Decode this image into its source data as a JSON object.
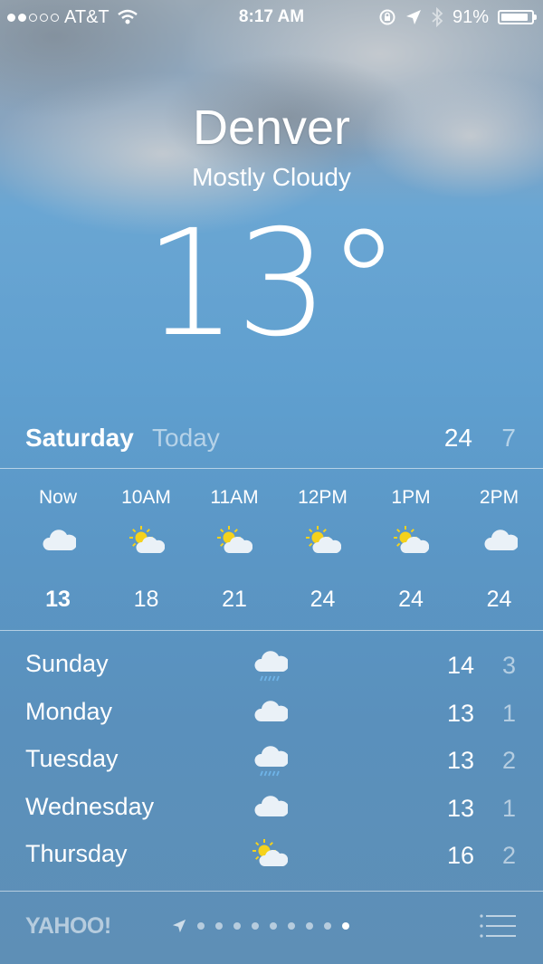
{
  "status_bar": {
    "carrier": "AT&T",
    "signal_bars_filled": 2,
    "signal_bars_total": 5,
    "time": "8:17 AM",
    "battery": "91%",
    "battery_level": 0.91
  },
  "header": {
    "city": "Denver",
    "condition": "Mostly Cloudy",
    "temperature": "13°"
  },
  "today": {
    "day": "Saturday",
    "label": "Today",
    "high": "24",
    "low": "7"
  },
  "hourly": [
    {
      "time": "Now",
      "icon": "cloud-icon",
      "temp": "13"
    },
    {
      "time": "10AM",
      "icon": "partly-sunny-icon",
      "temp": "18"
    },
    {
      "time": "11AM",
      "icon": "partly-sunny-icon",
      "temp": "21"
    },
    {
      "time": "12PM",
      "icon": "partly-sunny-icon",
      "temp": "24"
    },
    {
      "time": "1PM",
      "icon": "partly-sunny-icon",
      "temp": "24"
    },
    {
      "time": "2PM",
      "icon": "cloud-icon",
      "temp": "24"
    }
  ],
  "daily": [
    {
      "day": "Sunday",
      "icon": "rain-cloud-icon",
      "high": "14",
      "low": "3"
    },
    {
      "day": "Monday",
      "icon": "cloud-icon",
      "high": "13",
      "low": "1"
    },
    {
      "day": "Tuesday",
      "icon": "rain-cloud-icon",
      "high": "13",
      "low": "2"
    },
    {
      "day": "Wednesday",
      "icon": "cloud-icon",
      "high": "13",
      "low": "1"
    },
    {
      "day": "Thursday",
      "icon": "partly-sunny-icon",
      "high": "16",
      "low": "2"
    }
  ],
  "footer": {
    "brand": "YAHOO!",
    "page_count": 9,
    "active_page": 9
  },
  "colors": {
    "sky_top": "#9aa9b6",
    "sky_mid": "#6aa6d3",
    "sun": "#f5d21c",
    "cloud": "#eaf1f7",
    "rain": "#6fb4e8"
  }
}
